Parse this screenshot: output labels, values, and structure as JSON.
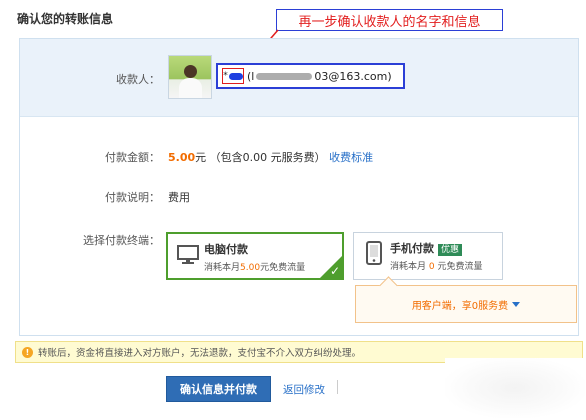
{
  "page": {
    "title": "确认您的转账信息"
  },
  "annotation": {
    "text": "再一步确认收款人的名字和信息"
  },
  "payee": {
    "label": "收款人：",
    "name_prefix": "*",
    "open_paren": "( ",
    "email_prefix": "l",
    "email_suffix": "03@163.com",
    "close_paren": " )"
  },
  "amount": {
    "label": "付款金额：",
    "value": "5.00",
    "unit": "元",
    "note": "（包含0.00 元服务费）",
    "link": "收费标准"
  },
  "description": {
    "label": "付款说明：",
    "value": "费用"
  },
  "terminal": {
    "label": "选择付款终端：",
    "options": [
      {
        "title": "电脑付款",
        "desc_prefix": "消耗本月",
        "desc_num": "5.00",
        "desc_suffix": "元免费流量",
        "selected": true
      },
      {
        "title": "手机付款",
        "badge": "优惠",
        "desc_prefix": "消耗本月",
        "desc_num": "0",
        "desc_suffix": "元免费流量",
        "selected": false
      }
    ],
    "promo": "用客户端，享0服务费"
  },
  "notice": {
    "text": "转账后，资金将直接进入对方账户，无法退款，支付宝不介入双方纠纷处理。"
  },
  "actions": {
    "confirm": "确认信息并付款",
    "back": "返回修改"
  },
  "colors": {
    "accent": "#f26c00",
    "link": "#2870c8",
    "selected": "#4e9e2d",
    "annotation": "#e21e1e",
    "highlight_box": "#2b3fd6"
  }
}
